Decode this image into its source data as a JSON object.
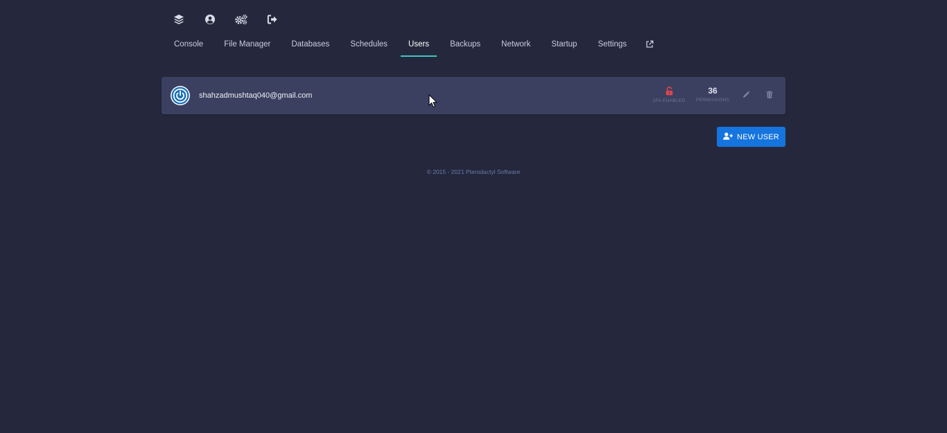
{
  "topbar": {
    "icons": [
      "layers-icon",
      "account-icon",
      "admin-cogs-icon",
      "logout-icon"
    ]
  },
  "tabs": [
    {
      "label": "Console",
      "active": false
    },
    {
      "label": "File Manager",
      "active": false
    },
    {
      "label": "Databases",
      "active": false
    },
    {
      "label": "Schedules",
      "active": false
    },
    {
      "label": "Users",
      "active": true
    },
    {
      "label": "Backups",
      "active": false
    },
    {
      "label": "Network",
      "active": false
    },
    {
      "label": "Startup",
      "active": false
    },
    {
      "label": "Settings",
      "active": false
    }
  ],
  "external_link_icon": "external-link-icon",
  "users": [
    {
      "email": "shahzadmushtaq040@gmail.com",
      "twofa_label": "2FA Enabled",
      "permissions_count": "36",
      "permissions_label": "Permissions"
    }
  ],
  "new_user_button": {
    "label": "NEW USER"
  },
  "footer": {
    "text": "© 2015 - 2021 Pterodactyl Software"
  },
  "colors": {
    "background": "#25283d",
    "row_background": "#3c4060",
    "accent_tab": "#3ec7c0",
    "primary_button": "#1574dd",
    "danger_lock": "#e0454f",
    "footer_text": "#6c78a6"
  }
}
